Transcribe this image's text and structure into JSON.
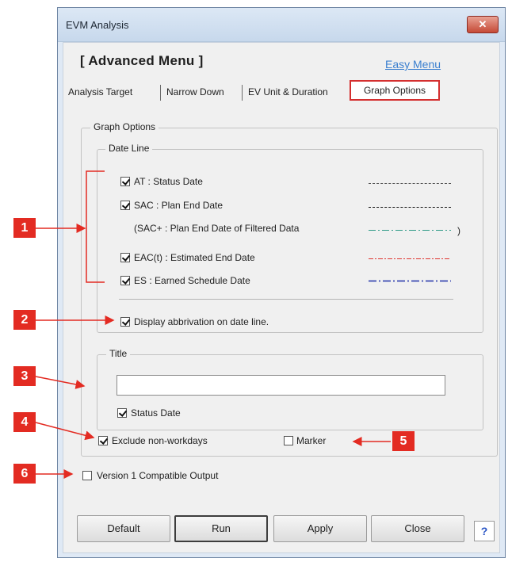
{
  "window": {
    "title": "EVM Analysis",
    "close_glyph": "✕"
  },
  "header": {
    "title": "[ Advanced Menu ]",
    "easy_menu": "Easy Menu"
  },
  "tabs": {
    "items": [
      "Analysis Target",
      "Narrow Down",
      "EV Unit & Duration"
    ],
    "active": "Graph Options"
  },
  "graph_options": {
    "group_label": "Graph Options",
    "date_line": {
      "group_label": "Date Line",
      "items": [
        {
          "label": "AT : Status Date",
          "checked": true,
          "line_color": "#555555",
          "line_style": "dashed"
        },
        {
          "label": "SAC : Plan End Date",
          "checked": true,
          "line_color": "#111111",
          "line_style": "dashed"
        },
        {
          "label": "(SAC+ : Plan End Date of Filtered Data",
          "suffix": ")",
          "line_color": "#2e9a86",
          "line_style": "dash-dot"
        },
        {
          "label": "EAC(t) : Estimated End Date",
          "checked": true,
          "line_color": "#e0342f",
          "line_style": "dash-dot"
        },
        {
          "label": "ES : Earned Schedule Date",
          "checked": true,
          "line_color": "#1d2fa8",
          "line_style": "dash-dot"
        }
      ],
      "display_abbrev": {
        "label": "Display abbrivation on date line.",
        "checked": true
      }
    },
    "title_group": {
      "group_label": "Title",
      "input_value": "",
      "status_date": {
        "label": "Status Date",
        "checked": true
      }
    },
    "exclude_nonworkdays": {
      "label": "Exclude non-workdays",
      "checked": true
    },
    "marker": {
      "label": "Marker",
      "checked": false
    }
  },
  "version1": {
    "label": "Version 1 Compatible Output",
    "checked": false
  },
  "buttons": {
    "default": "Default",
    "run": "Run",
    "apply": "Apply",
    "close": "Close",
    "help": "?"
  },
  "annotations": [
    "1",
    "2",
    "3",
    "4",
    "5",
    "6"
  ],
  "colors": {
    "accent_red": "#e32b22",
    "link_blue": "#3a7fcf"
  }
}
